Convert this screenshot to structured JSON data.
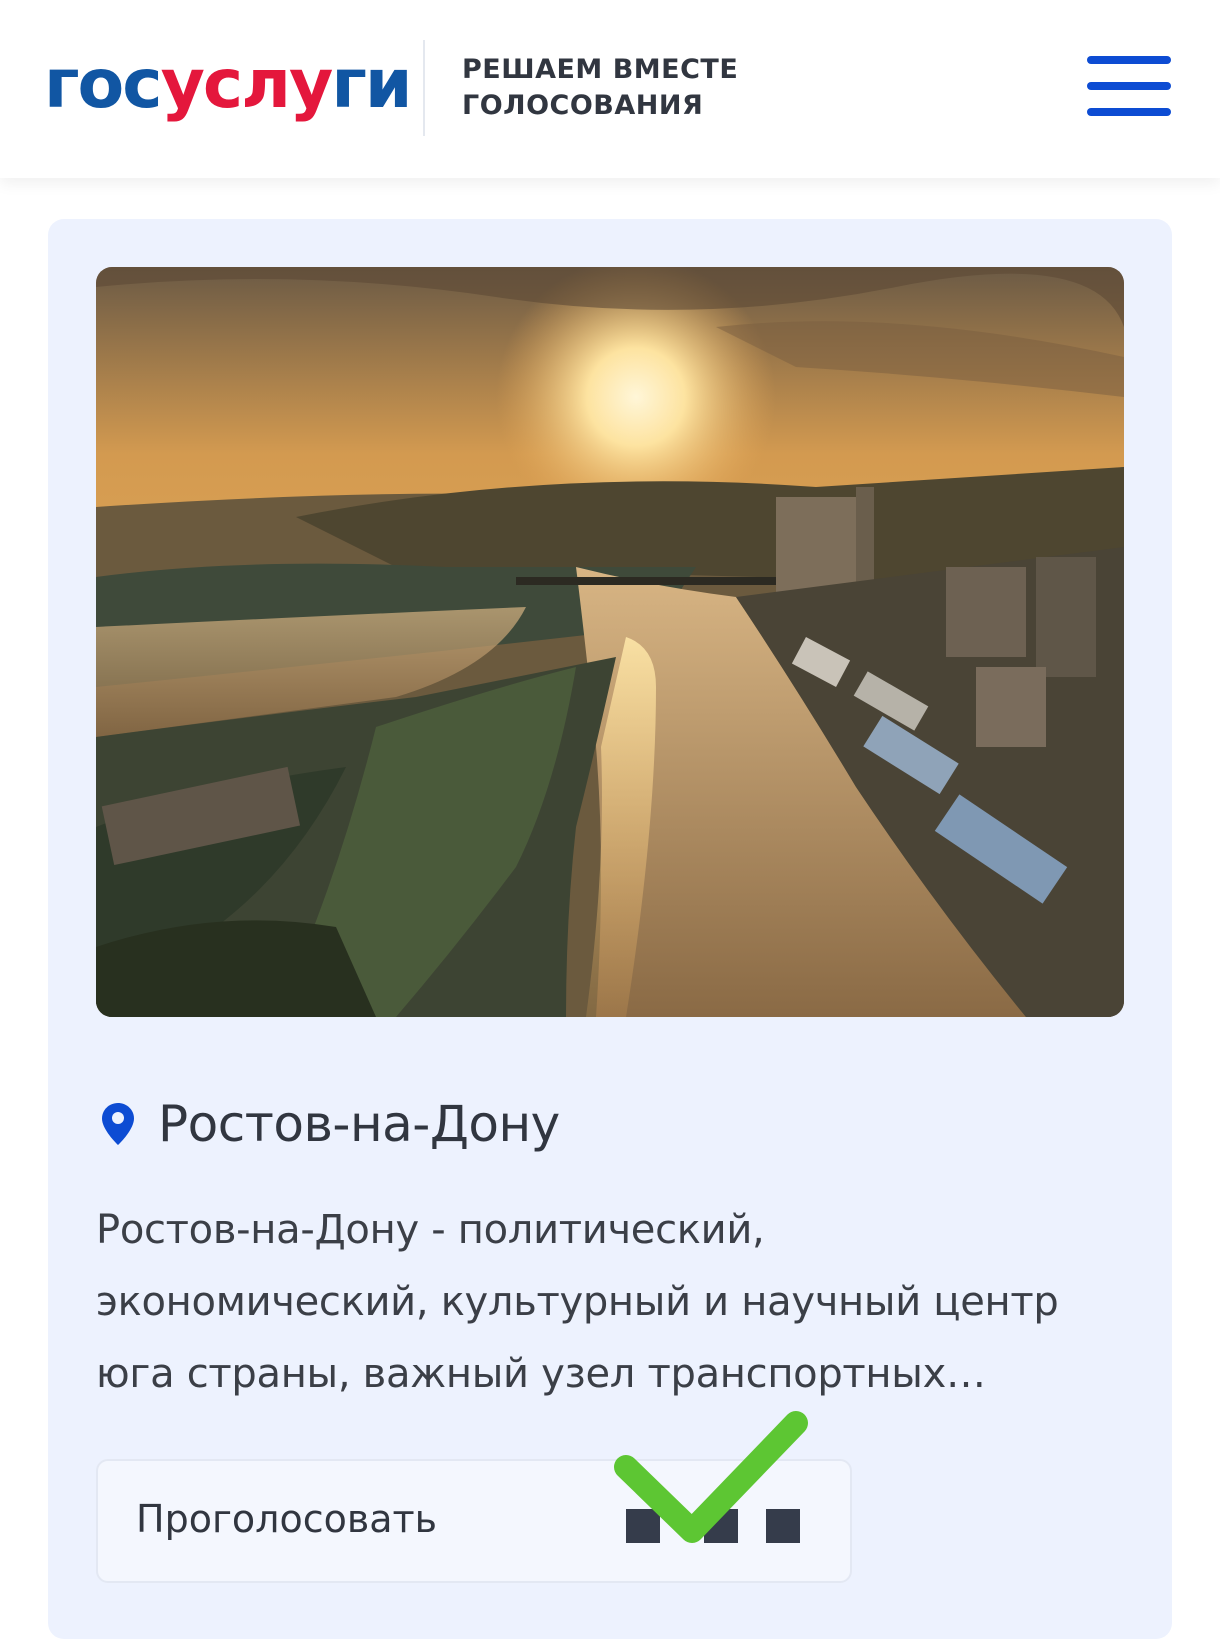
{
  "header": {
    "logo": {
      "part_a": "гос",
      "part_b": "услу",
      "part_c": "ги"
    },
    "tagline_line1": "РЕШАЕМ ВМЕСТЕ",
    "tagline_line2": "ГОЛОСОВАНИЯ",
    "menu_icon": "hamburger-menu-icon"
  },
  "card": {
    "image_alt": "Ростов-на-Дону",
    "location_icon": "map-pin-icon",
    "title": "Ростов-на-Дону",
    "description_lines": [
      "Ростов-на-Дону - политический,",
      "экономический, культурный и научный центр",
      "юга страны, важный узел транспортных…"
    ],
    "vote": {
      "label": "Проголосовать",
      "check_icon": "checkmark-icon"
    }
  },
  "colors": {
    "brand_blue": "#1156a3",
    "brand_red": "#e4173c",
    "menu_blue": "#0d4cd3",
    "card_bg": "#edf2fe",
    "check_green": "#5dc633"
  }
}
